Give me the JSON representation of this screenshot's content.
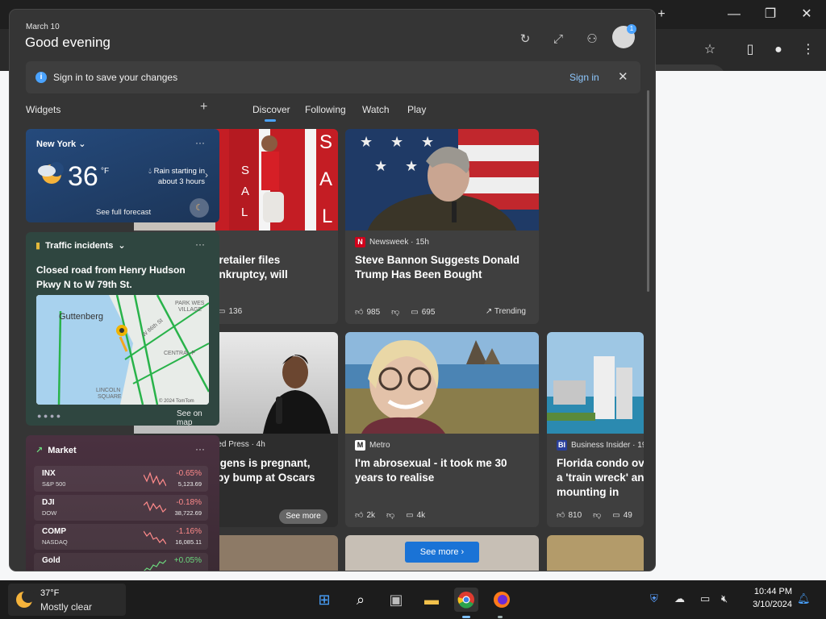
{
  "header": {
    "date": "March 10",
    "greeting": "Good evening",
    "avatar_badge": "1"
  },
  "signin_banner": {
    "text": "Sign in to save your changes",
    "link": "Sign in"
  },
  "nav": {
    "widgets_label": "Widgets",
    "tabs": [
      {
        "label": "Discover"
      },
      {
        "label": "Following"
      },
      {
        "label": "Watch"
      },
      {
        "label": "Play"
      }
    ]
  },
  "weather": {
    "location": "New York",
    "temperature": "36",
    "unit": "°F",
    "rain": "Rain starting in about 3 hours",
    "forecast_link": "See full forecast"
  },
  "traffic": {
    "title": "Traffic incidents",
    "headline": "Closed road from Henry Hudson Pkwy N to W 79th St.",
    "map_place": "Guttenberg",
    "map_labels": [
      "PARK WES",
      "VILLAGE",
      "W 86th St",
      "CENTRAL P",
      "LINCOLN",
      "SQUARE"
    ],
    "map_credit": "© 2024 TomTom",
    "see_map": "See on map"
  },
  "market": {
    "title": "Market",
    "rows": [
      {
        "symbol": "INX",
        "name": "S&P 500",
        "change": "-0.65%",
        "value": "5,123.69",
        "positive": false
      },
      {
        "symbol": "DJI",
        "name": "DOW",
        "change": "-0.18%",
        "value": "38,722.69",
        "positive": false
      },
      {
        "symbol": "COMP",
        "name": "NASDAQ",
        "change": "-1.16%",
        "value": "16,085.11",
        "positive": false
      },
      {
        "symbol": "Gold",
        "name": "",
        "change": "+0.05%",
        "value": "",
        "positive": true
      }
    ]
  },
  "news": [
    {
      "source": "",
      "title": "l retailer files\nankruptcy, will",
      "stats": [
        "136"
      ],
      "image_words": [
        "S",
        "A",
        "L",
        "S",
        "A",
        "L",
        "E"
      ]
    },
    {
      "source": "Newsweek · 15h",
      "title": "Steve Bannon Suggests Donald Trump Has Been Bought",
      "stats": [
        "985",
        "695"
      ],
      "trending": "Trending"
    },
    {
      "source": "red Press · 4h",
      "title": "lgens is pregnant,\nby bump at Oscars",
      "stats": [],
      "see_more": "See more"
    },
    {
      "source": "Metro",
      "title": "I'm abrosexual - it took me 30 years to realise",
      "stats": [
        "2k",
        "4k"
      ]
    },
    {
      "source": "Business Insider · 19h",
      "title": "Florida condo ov in a 'train wreck' and mounting in",
      "stats": [
        "810",
        "49"
      ]
    }
  ],
  "see_more_button": "See more",
  "taskbar": {
    "weather_temp": "37°F",
    "weather_cond": "Mostly clear",
    "time": "10:44 PM",
    "date": "3/10/2024"
  },
  "colors": {
    "accent": "#1a73d6",
    "panel": "#353535",
    "negative": "#ff8a8a",
    "positive": "#6cd97e"
  }
}
